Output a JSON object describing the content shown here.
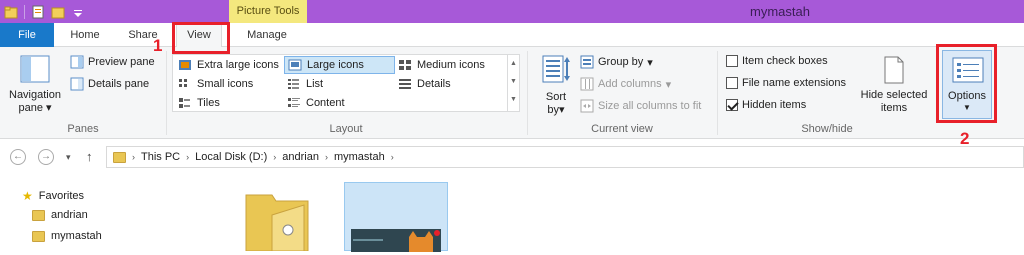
{
  "window": {
    "title": "mymastah",
    "contextual_tab": "Picture Tools",
    "accent_color": "#a759d8"
  },
  "tabs": [
    "File",
    "Home",
    "Share",
    "View",
    "Manage"
  ],
  "ribbon": {
    "panes": {
      "label": "Panes",
      "navigation_pane": "Navigation",
      "navigation_pane_2": "pane",
      "preview_pane": "Preview pane",
      "details_pane": "Details pane"
    },
    "layout": {
      "label": "Layout",
      "items": [
        "Extra large icons",
        "Large icons",
        "Medium icons",
        "Small icons",
        "List",
        "Details",
        "Tiles",
        "Content"
      ],
      "selected": "Large icons"
    },
    "current_view": {
      "label": "Current view",
      "sort_by": "Sort",
      "sort_by_2": "by",
      "group_by": "Group by",
      "add_columns": "Add columns",
      "size_columns": "Size all columns to fit"
    },
    "show_hide": {
      "label": "Show/hide",
      "item_check_boxes": "Item check boxes",
      "file_name_extensions": "File name extensions",
      "hidden_items": "Hidden items",
      "hide_selected": "Hide selected",
      "hide_selected_2": "items",
      "checked": {
        "item_check_boxes": false,
        "file_name_extensions": false,
        "hidden_items": true
      }
    },
    "options": "Options"
  },
  "annotations": {
    "one": "1",
    "two": "2"
  },
  "address": {
    "crumbs": [
      "This PC",
      "Local Disk (D:)",
      "andrian",
      "mymastah"
    ]
  },
  "nav": {
    "favorites": "Favorites",
    "items": [
      "andrian",
      "mymastah"
    ]
  },
  "icons": {
    "back": "back-arrow-icon",
    "forward": "forward-arrow-icon",
    "up": "up-arrow-icon",
    "folder": "folder-icon"
  }
}
